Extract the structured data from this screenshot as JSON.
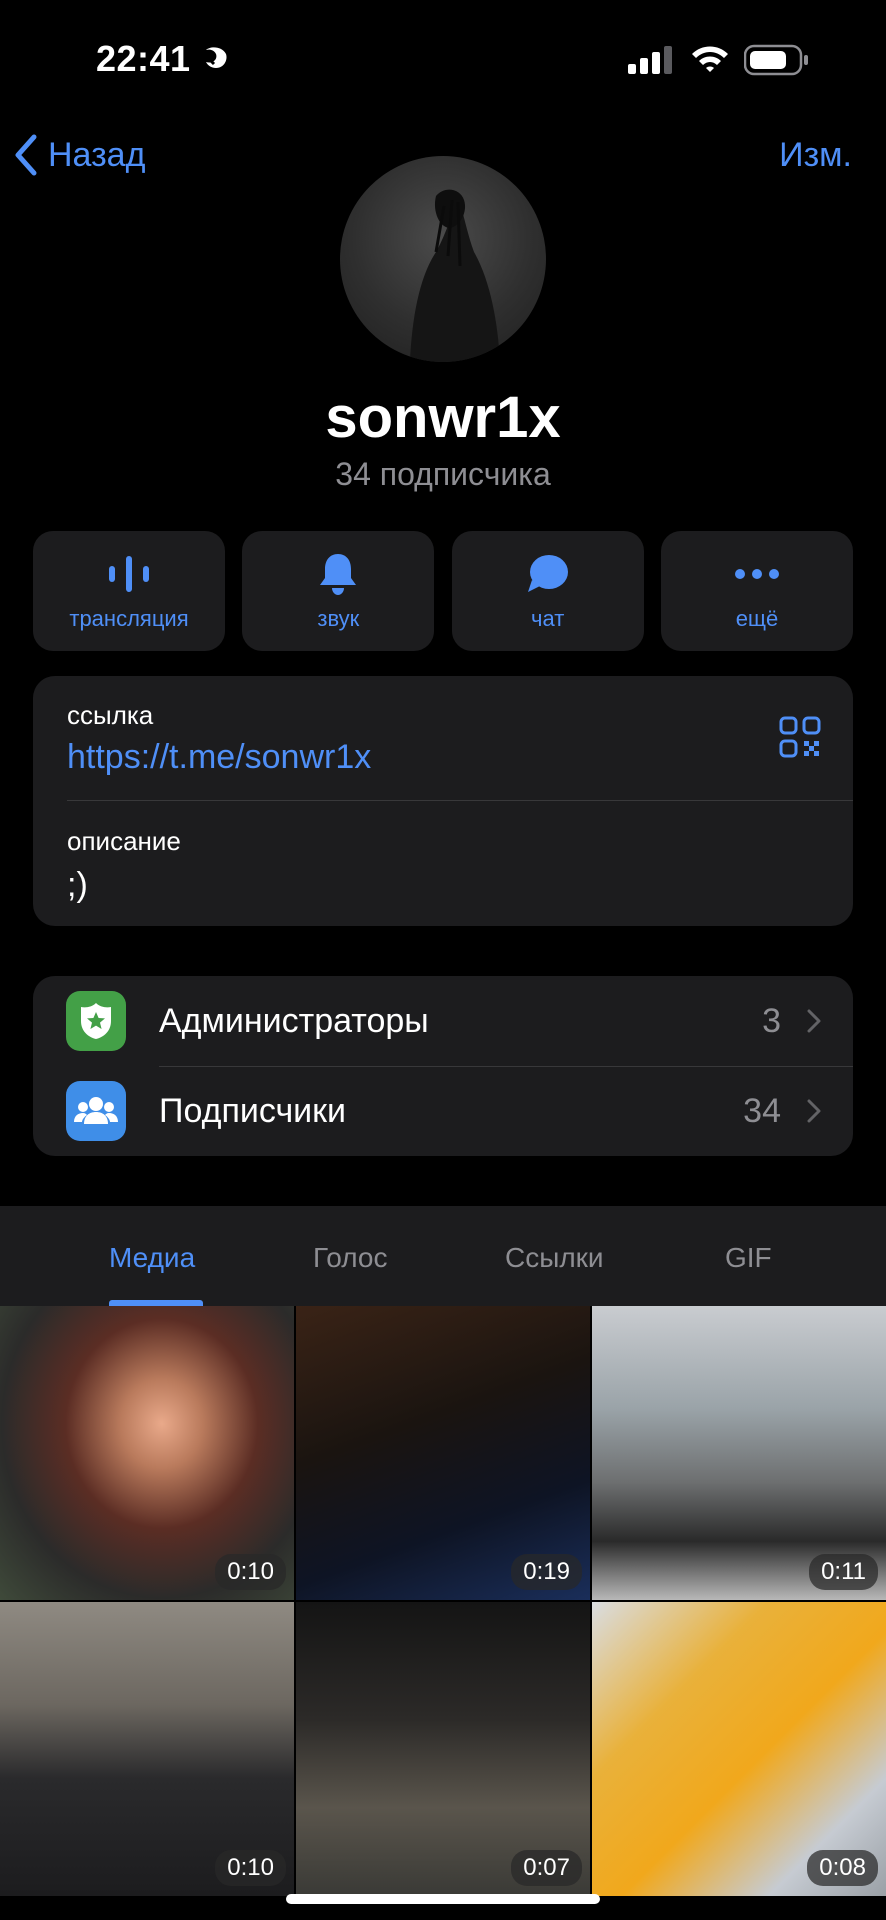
{
  "status_bar": {
    "time": "22:41",
    "icons": [
      "moon-icon",
      "signal-icon",
      "wifi-icon",
      "battery-icon"
    ]
  },
  "nav": {
    "back_label": "Назад",
    "edit_label": "Изм."
  },
  "profile": {
    "name": "sonwr1x",
    "subscribers": "34 подписчика"
  },
  "actions": [
    {
      "label": "трансляция",
      "icon": "broadcast-icon"
    },
    {
      "label": "звук",
      "icon": "bell-icon"
    },
    {
      "label": "чат",
      "icon": "chat-bubble-icon"
    },
    {
      "label": "ещё",
      "icon": "more-dots-icon"
    }
  ],
  "info": {
    "link_label": "ссылка",
    "link_value": "https://t.me/sonwr1x",
    "description_label": "описание",
    "description_value": ";)"
  },
  "list": [
    {
      "title": "Администраторы",
      "count": "3",
      "icon": "shield-badge-icon",
      "color": "#43a047"
    },
    {
      "title": "Подписчики",
      "count": "34",
      "icon": "people-icon",
      "color": "#3f8ee8"
    }
  ],
  "tabs": [
    {
      "label": "Медиа",
      "active": true
    },
    {
      "label": "Голос",
      "active": false
    },
    {
      "label": "Ссылки",
      "active": false
    },
    {
      "label": "GIF",
      "active": false
    }
  ],
  "media": [
    {
      "duration": "0:10"
    },
    {
      "duration": "0:19"
    },
    {
      "duration": "0:11"
    },
    {
      "duration": "0:10"
    },
    {
      "duration": "0:07"
    },
    {
      "duration": "0:08"
    }
  ],
  "colors": {
    "accent": "#4f8ff7",
    "card": "#1c1c1e",
    "secondary_text": "#8e8e93"
  }
}
